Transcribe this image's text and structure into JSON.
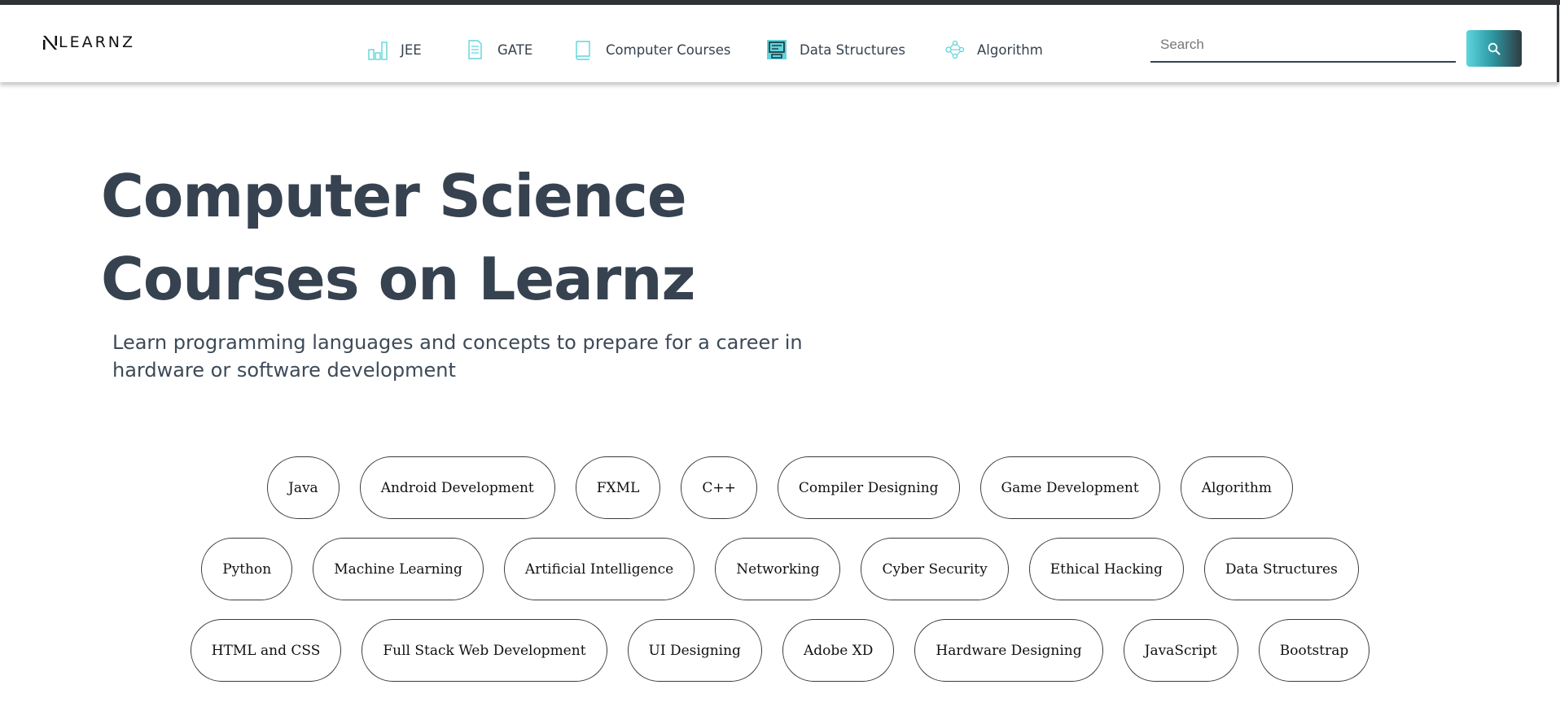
{
  "brand": {
    "name": "LEARNZ",
    "logo_icon": "learnz-logo-icon"
  },
  "nav": [
    {
      "label": "JEE",
      "icon": "bar-chart-icon"
    },
    {
      "label": "GATE",
      "icon": "document-icon"
    },
    {
      "label": "Computer Courses",
      "icon": "book-icon"
    },
    {
      "label": "Data Structures",
      "icon": "computer-screen-icon"
    },
    {
      "label": "Algorithm",
      "icon": "network-graph-icon"
    }
  ],
  "search": {
    "placeholder": "Search",
    "value": "",
    "button_icon": "search-icon"
  },
  "hero": {
    "title": "Computer Science Courses on Learnz",
    "subtitle": "Learn programming languages and concepts to prepare for a career in hardware or software development"
  },
  "courses": [
    [
      "Java",
      "Android Development",
      "FXML",
      "C++",
      "Compiler Designing",
      "Game Development",
      "Algorithm"
    ],
    [
      "Python",
      "Machine Learning",
      "Artificial Intelligence",
      "Networking",
      "Cyber Security",
      "Ethical Hacking",
      "Data Structures"
    ],
    [
      "HTML and CSS",
      "Full Stack Web Development",
      "UI Designing",
      "Adobe XD",
      "Hardware Designing",
      "JavaScript",
      "Bootstrap"
    ]
  ],
  "colors": {
    "accent": "#5fd5dc",
    "text": "#36424f",
    "topbar": "#2f3236"
  }
}
